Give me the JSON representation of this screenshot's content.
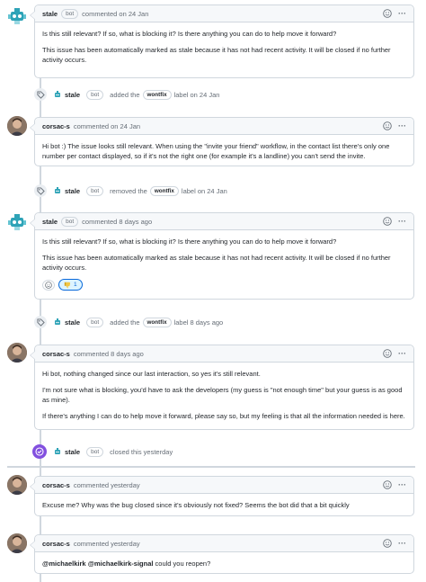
{
  "comments": [
    {
      "author": "stale",
      "badge": "bot",
      "meta": "commented on 24 Jan",
      "paragraphs": [
        "Is this still relevant? If so, what is blocking it? Is there anything you can do to help move it forward?",
        "This issue has been automatically marked as stale because it has not had recent activity. It will be closed if no further activity occurs."
      ]
    },
    {
      "author": "corsac-s",
      "meta": "commented on 24 Jan",
      "paragraphs": [
        "Hi bot :) The issue looks still relevant. When using the \"invite your friend\" workflow, in the contact list there's only one number per contact displayed, so if it's not the right one (for example it's a landline) you can't send the invite."
      ]
    },
    {
      "author": "stale",
      "badge": "bot",
      "meta": "commented 8 days ago",
      "paragraphs": [
        "Is this still relevant? If so, what is blocking it? Is there anything you can do to help move it forward?",
        "This issue has been automatically marked as stale because it has not had recent activity. It will be closed if no further activity occurs."
      ],
      "reaction_count": "1"
    },
    {
      "author": "corsac-s",
      "meta": "commented 8 days ago",
      "paragraphs": [
        "Hi bot, nothing changed since our last interaction, so yes it's still relevant.",
        "I'm not sure what is blocking, you'd have to ask the developers (my guess is \"not enough time\" but your guess is as good as mine).",
        "If there's anything I can do to help move it forward, please say so, but my feeling is that all the information needed is here."
      ]
    },
    {
      "author": "corsac-s",
      "meta": "commented yesterday",
      "paragraphs": [
        "Excuse me? Why was the bug closed since it's obviously not fixed? Seems the bot did that a bit quickly"
      ]
    },
    {
      "author": "corsac-s",
      "meta": "commented yesterday",
      "mention1": "@michaelkirk",
      "mention2": "@michaelkirk-signal",
      "paragraph_tail": "could you reopen?"
    }
  ],
  "events": [
    {
      "actor": "stale",
      "badge": "bot",
      "action": "added the",
      "label": "wontfix",
      "suffix": "label on 24 Jan"
    },
    {
      "actor": "stale",
      "badge": "bot",
      "action": "removed the",
      "label": "wontfix",
      "suffix": "label on 24 Jan"
    },
    {
      "actor": "stale",
      "badge": "bot",
      "action": "added the",
      "label": "wontfix",
      "suffix": "label 8 days ago"
    },
    {
      "actor": "stale",
      "badge": "bot",
      "action": "closed this yesterday"
    }
  ],
  "colors": {
    "border": "#d0d7de",
    "header_bg": "#f6f8fa",
    "muted_text": "#656d76",
    "closed_purple": "#8250df",
    "reaction_blue": "#0969da",
    "bot_teal": "#2ea3b7"
  },
  "icons": [
    "robot-avatar-icon",
    "user-avatar-icon",
    "smiley-icon",
    "kebab-menu-icon",
    "tag-icon",
    "closed-issue-icon",
    "thumbs-down-icon"
  ]
}
